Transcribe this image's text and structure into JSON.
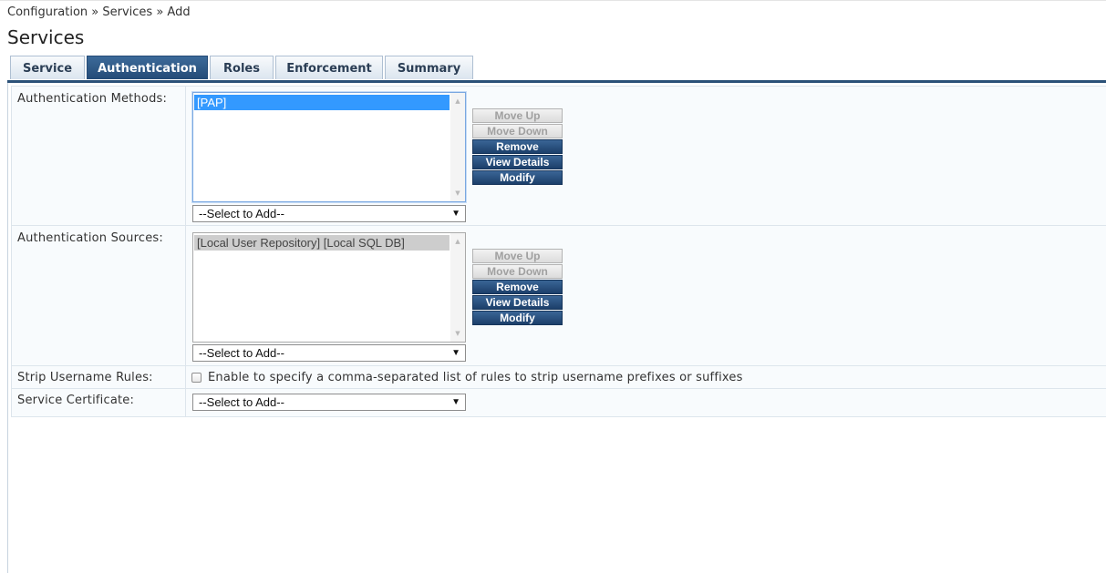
{
  "breadcrumb": "Configuration » Services » Add",
  "page_title": "Services",
  "tabs": [
    {
      "label": "Service",
      "active": false
    },
    {
      "label": "Authentication",
      "active": true
    },
    {
      "label": "Roles",
      "active": false
    },
    {
      "label": "Enforcement",
      "active": false
    },
    {
      "label": "Summary",
      "active": false
    }
  ],
  "auth_methods": {
    "label": "Authentication Methods:",
    "items": [
      "[PAP]"
    ],
    "select_placeholder": "--Select to Add--",
    "buttons": {
      "move_up": "Move Up",
      "move_down": "Move Down",
      "remove": "Remove",
      "view_details": "View Details",
      "modify": "Modify"
    }
  },
  "auth_sources": {
    "label": "Authentication Sources:",
    "items": [
      "[Local User Repository] [Local SQL DB]"
    ],
    "select_placeholder": "--Select to Add--",
    "buttons": {
      "move_up": "Move Up",
      "move_down": "Move Down",
      "remove": "Remove",
      "view_details": "View Details",
      "modify": "Modify"
    }
  },
  "strip_username": {
    "label": "Strip Username Rules:",
    "checkbox_label": "Enable to specify a comma-separated list of rules to strip username prefixes or suffixes",
    "checked": false
  },
  "service_certificate": {
    "label": "Service Certificate:",
    "select_placeholder": "--Select to Add--"
  },
  "colors": {
    "tab_active": "#2b5178",
    "button_primary": "#1c3f6a",
    "selection_active": "#3399ff"
  }
}
